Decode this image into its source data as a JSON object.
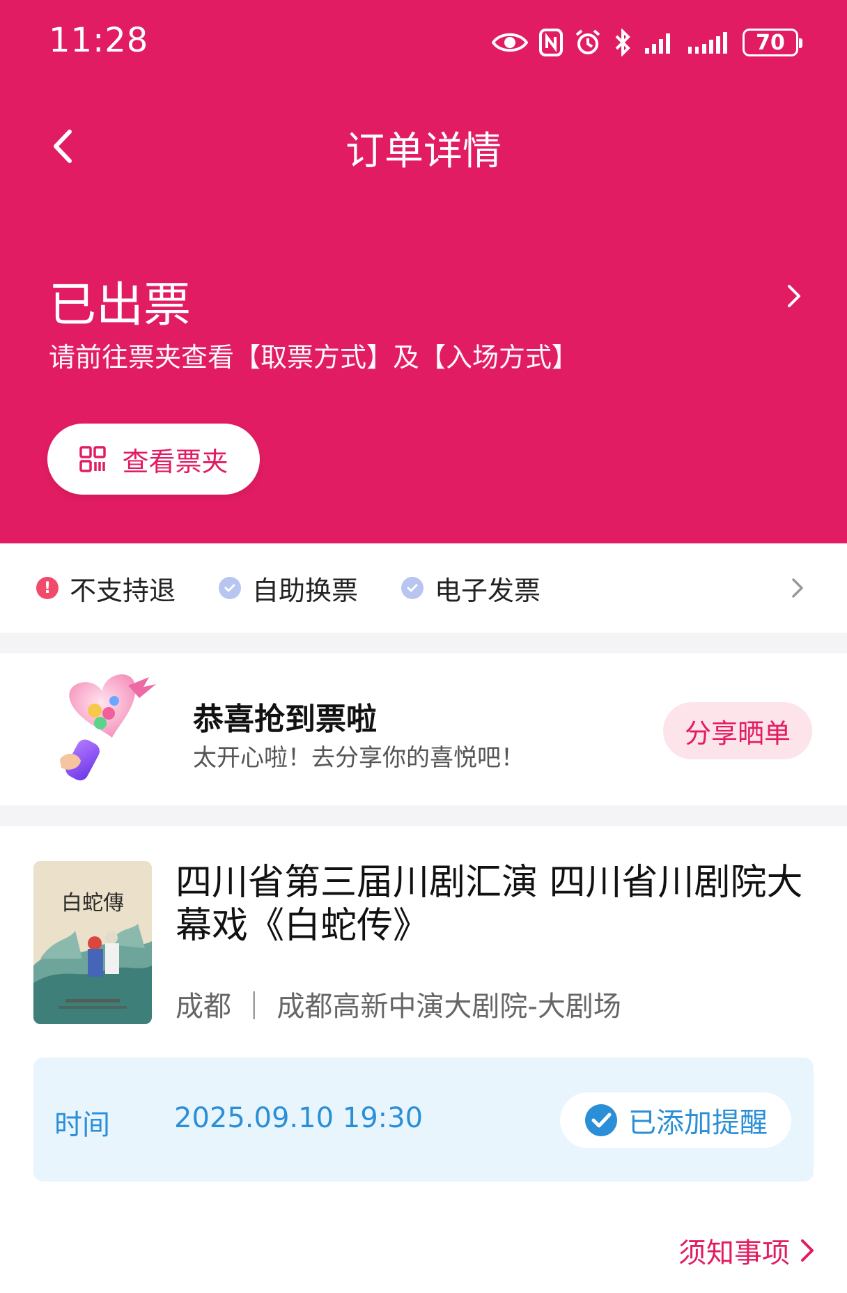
{
  "status_bar": {
    "time": "11:28",
    "battery": "70"
  },
  "nav": {
    "title": "订单详情"
  },
  "order_status": {
    "title": "已出票",
    "subtitle": "请前往票夹查看【取票方式】及【入场方式】",
    "view_ticket_button": "查看票夹"
  },
  "features": [
    {
      "label": "不支持退",
      "icon": "warning-icon"
    },
    {
      "label": "自助换票",
      "icon": "check-icon"
    },
    {
      "label": "电子发票",
      "icon": "check-icon"
    }
  ],
  "celebrate": {
    "title": "恭喜抢到票啦",
    "subtitle": "太开心啦！去分享你的喜悦吧！",
    "share_button": "分享晒单"
  },
  "show": {
    "title": "四川省第三届川剧汇演 四川省川剧院大幕戏《白蛇传》",
    "venue": "成都 ｜ 成都高新中演大剧院-大剧场",
    "poster_title": "白蛇傳"
  },
  "time_info": {
    "label": "时间",
    "value": "2025.09.10 19:30",
    "reminder_button": "已添加提醒"
  },
  "notice_link": "须知事项",
  "colors": {
    "brand": "#e21c62",
    "info_blue": "#2a8fd7",
    "info_bg": "#e9f5fd"
  }
}
